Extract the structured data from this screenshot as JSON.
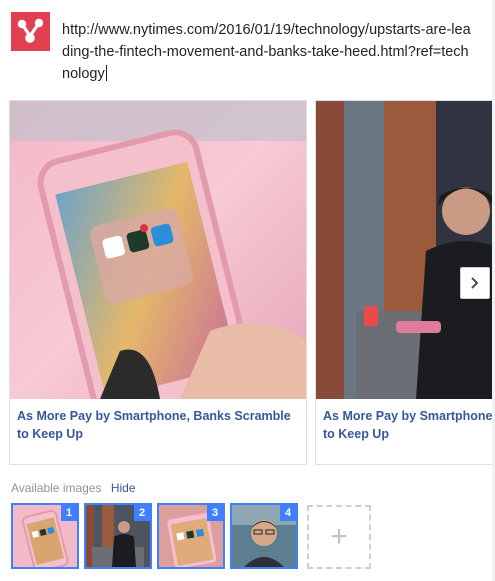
{
  "app": {
    "icon": "share-app-icon"
  },
  "url": {
    "text": "http://www.nytimes.com/2016/01/19/technology/upstarts-are-leading-the-fintech-movement-and-banks-take-heed.html?ref=technology"
  },
  "carousel": {
    "cards": [
      {
        "title": "As More Pay by Smartphone, Banks Scramble to Keep Up",
        "image": "pink-fur-phone"
      },
      {
        "title": "As More Pay by Smartphone, Banks Scramble to Keep Up",
        "image": "woman-at-window"
      }
    ],
    "next_icon": "chevron-right-icon"
  },
  "available_images": {
    "label": "Available images",
    "hide_label": "Hide",
    "thumbnails": [
      {
        "number": "1",
        "image": "pink-fur-phone"
      },
      {
        "number": "2",
        "image": "woman-at-window"
      },
      {
        "number": "3",
        "image": "pink-fur-phone"
      },
      {
        "number": "4",
        "image": "man-portrait"
      }
    ],
    "add_label": "+"
  },
  "colors": {
    "brand_red": "#e0404f",
    "link_blue": "#365899",
    "selection_blue": "#4080ff",
    "border": "#dddfe2"
  }
}
